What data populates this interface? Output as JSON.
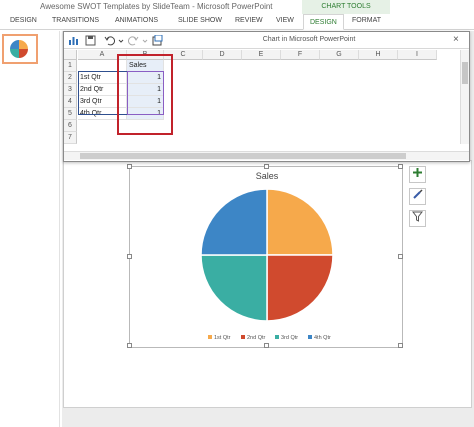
{
  "app": {
    "window_title": "Awesome SWOT Templates by SlideTeam - Microsoft PowerPoint",
    "contextual_group": "CHART TOOLS"
  },
  "ribbon": {
    "tabs": [
      {
        "label": "DESIGN"
      },
      {
        "label": "TRANSITIONS"
      },
      {
        "label": "ANIMATIONS"
      },
      {
        "label": "SLIDE SHOW"
      },
      {
        "label": "REVIEW"
      },
      {
        "label": "VIEW"
      },
      {
        "label": "DESIGN"
      },
      {
        "label": "FORMAT"
      }
    ]
  },
  "chart_window": {
    "title": "Chart in Microsoft PowerPoint",
    "close": "×",
    "columns": [
      "A",
      "B",
      "C",
      "D",
      "E",
      "F",
      "G",
      "H",
      "I"
    ],
    "rows": [
      "1",
      "2",
      "3",
      "4",
      "5",
      "6",
      "7"
    ],
    "header_value": "Sales",
    "data_rows": [
      {
        "label": "1st Qtr",
        "value": "1"
      },
      {
        "label": "2nd Qtr",
        "value": "1"
      },
      {
        "label": "3rd Qtr",
        "value": "1"
      },
      {
        "label": "4th Qtr",
        "value": "1"
      }
    ]
  },
  "chart_data": {
    "type": "pie",
    "title": "Sales",
    "categories": [
      "1st Qtr",
      "2nd Qtr",
      "3rd Qtr",
      "4th Qtr"
    ],
    "values": [
      1,
      1,
      1,
      1
    ],
    "colors": [
      "#f6a94b",
      "#d04a2e",
      "#3aaea3",
      "#3d86c6"
    ],
    "legend_position": "bottom"
  },
  "icons": {
    "add_element": "plus-icon",
    "styles": "brush-icon",
    "filter": "filter-icon"
  }
}
